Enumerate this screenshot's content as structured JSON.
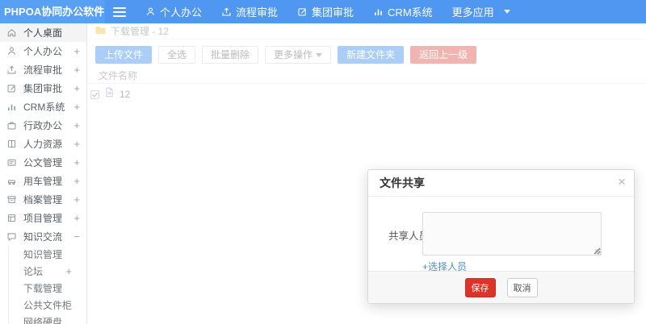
{
  "navbar": {
    "logo": "PHPOA协同办公软件",
    "items": [
      {
        "label": "个人办公",
        "icon": "person-icon"
      },
      {
        "label": "流程审批",
        "icon": "process-upload-icon"
      },
      {
        "label": "集团审批",
        "icon": "edit-square-icon"
      },
      {
        "label": "CRM系统",
        "icon": "bar-chart-icon"
      },
      {
        "label": "更多应用",
        "icon": "caret-down-icon"
      }
    ]
  },
  "sidebar": {
    "items": [
      {
        "label": "个人桌面",
        "icon": "home-icon",
        "expander": ""
      },
      {
        "label": "个人办公",
        "icon": "person-icon",
        "expander": "+"
      },
      {
        "label": "流程审批",
        "icon": "process-upload-icon",
        "expander": "+"
      },
      {
        "label": "集团审批",
        "icon": "edit-square-icon",
        "expander": "+"
      },
      {
        "label": "CRM系统",
        "icon": "bar-chart-icon",
        "expander": "+"
      },
      {
        "label": "行政办公",
        "icon": "briefcase-icon",
        "expander": "+"
      },
      {
        "label": "人力资源",
        "icon": "book-icon",
        "expander": "+"
      },
      {
        "label": "公文管理",
        "icon": "document-icon",
        "expander": "+"
      },
      {
        "label": "用车管理",
        "icon": "car-icon",
        "expander": "+"
      },
      {
        "label": "档案管理",
        "icon": "archive-icon",
        "expander": "+"
      },
      {
        "label": "项目管理",
        "icon": "project-icon",
        "expander": "+"
      },
      {
        "label": "知识交流",
        "icon": "chat-icon",
        "expander": "−"
      }
    ],
    "subitems": [
      {
        "label": "知识管理",
        "expander": ""
      },
      {
        "label": "论坛",
        "expander": "+"
      },
      {
        "label": "下载管理",
        "expander": ""
      },
      {
        "label": "公共文件柜",
        "expander": ""
      },
      {
        "label": "网络硬盘",
        "expander": ""
      }
    ]
  },
  "content": {
    "breadcrumb": {
      "icon": "folder-icon",
      "text": "下载管理 - 12"
    },
    "toolbar": {
      "upload": "上传文件",
      "select_all": "全选",
      "batch_delete": "批量删除",
      "more_actions": "更多操作",
      "new_folder": "新建文件夹",
      "back": "返回上一级"
    },
    "table": {
      "header": "文件名称",
      "rows": [
        {
          "name": "12",
          "checked": true
        }
      ]
    }
  },
  "modal": {
    "title": "文件共享",
    "close": "×",
    "field_label": "共享人员",
    "textarea_value": "",
    "picker_link": "+选择人员",
    "save": "保存",
    "cancel": "取消"
  },
  "colors": {
    "navbar_bg": "#4f97f0",
    "primary_blue": "#4493ef",
    "danger_red": "#e25a50",
    "save_red": "#d9352b",
    "link_blue": "#4193d5",
    "folder_yellow": "#f2c14e"
  }
}
